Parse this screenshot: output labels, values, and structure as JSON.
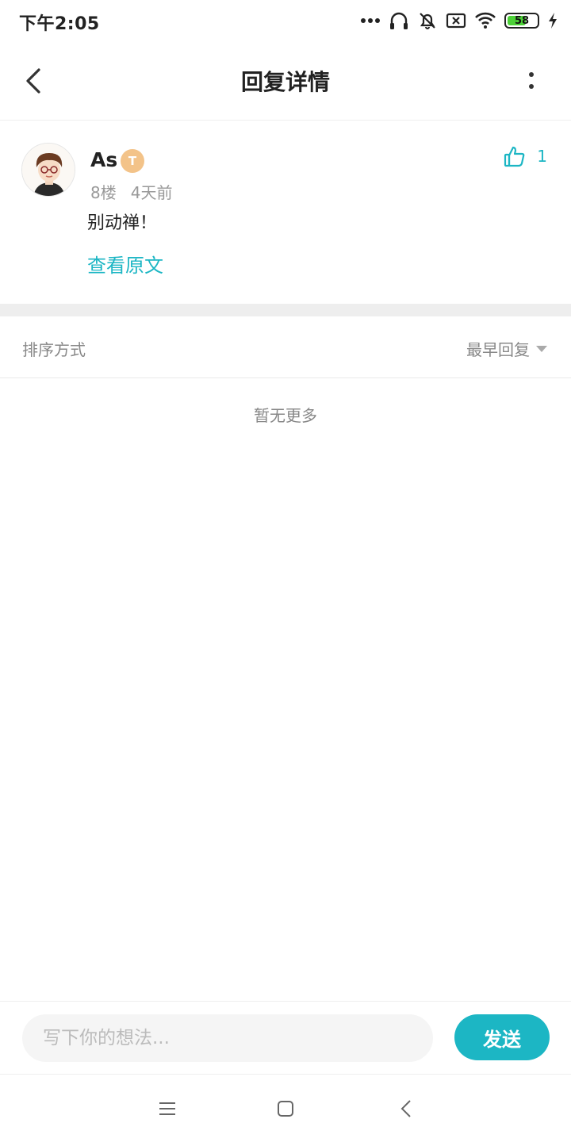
{
  "status_bar": {
    "time": "下午2:05",
    "battery_level": "58",
    "icons": [
      "more-dots-icon",
      "headset-icon",
      "mute-bell-icon",
      "sim-off-icon",
      "wifi-icon",
      "battery-icon",
      "charging-icon"
    ]
  },
  "header": {
    "title": "回复详情",
    "back_icon": "back-chevron-icon",
    "more_icon": "more-vertical-icon"
  },
  "comment": {
    "username": "As",
    "level_badge": "T",
    "floor": "8楼",
    "time_ago": "4天前",
    "text": "别动禅！",
    "view_original": "查看原文",
    "like_count": "1"
  },
  "sort": {
    "label": "排序方式",
    "selected": "最早回复"
  },
  "empty_text": "暂无更多",
  "reply_input": {
    "placeholder": "写下你的想法..."
  },
  "send_label": "发送",
  "colors": {
    "accent": "#1cb6c4",
    "badge": "#f3c389"
  }
}
